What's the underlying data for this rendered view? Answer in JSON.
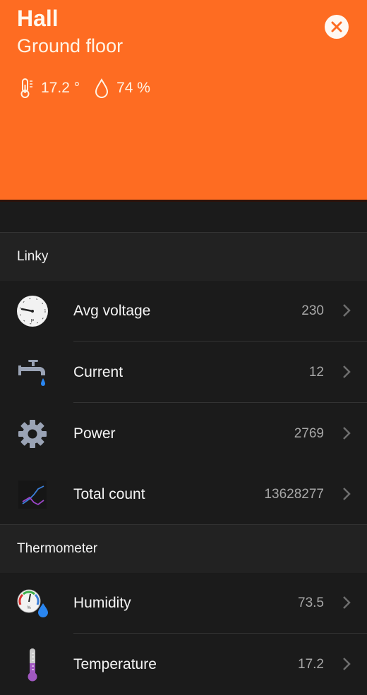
{
  "header": {
    "room": "Hall",
    "floor": "Ground floor",
    "temperature": "17.2 °",
    "humidity": "74 %",
    "bg_color": "#fe6c22",
    "close_icon": "close-icon"
  },
  "sections": [
    {
      "title": "Linky",
      "items": [
        {
          "label": "Avg voltage",
          "value": "230",
          "icon": "gauge-icon"
        },
        {
          "label": "Current",
          "value": "12",
          "icon": "faucet-icon"
        },
        {
          "label": "Power",
          "value": "2769",
          "icon": "gear-icon"
        },
        {
          "label": "Total count",
          "value": "13628277",
          "icon": "line-chart-icon"
        }
      ]
    },
    {
      "title": "Thermometer",
      "items": [
        {
          "label": "Humidity",
          "value": "73.5",
          "icon": "hygrometer-icon"
        },
        {
          "label": "Temperature",
          "value": "17.2",
          "icon": "thermometer-icon"
        }
      ]
    }
  ]
}
